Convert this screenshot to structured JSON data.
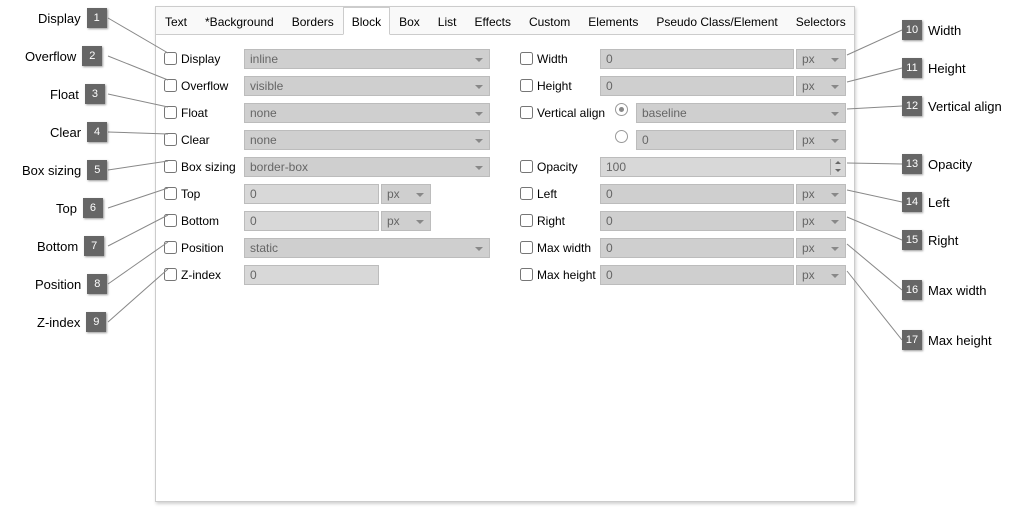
{
  "tabs": [
    "Text",
    "*Background",
    "Borders",
    "Block",
    "Box",
    "List",
    "Effects",
    "Custom",
    "Elements",
    "Pseudo Class/Element",
    "Selectors"
  ],
  "active_tab": 3,
  "left": {
    "display": {
      "label": "Display",
      "value": "inline"
    },
    "overflow": {
      "label": "Overflow",
      "value": "visible"
    },
    "float": {
      "label": "Float",
      "value": "none"
    },
    "clear": {
      "label": "Clear",
      "value": "none"
    },
    "boxsizing": {
      "label": "Box sizing",
      "value": "border-box"
    },
    "top": {
      "label": "Top",
      "value": "0",
      "unit": "px"
    },
    "bottom": {
      "label": "Bottom",
      "value": "0",
      "unit": "px"
    },
    "position": {
      "label": "Position",
      "value": "static"
    },
    "zindex": {
      "label": "Z-index",
      "value": "0"
    }
  },
  "right": {
    "width": {
      "label": "Width",
      "value": "0",
      "unit": "px"
    },
    "height": {
      "label": "Height",
      "value": "0",
      "unit": "px"
    },
    "valign": {
      "label": "Vertical align",
      "option": "baseline",
      "value": "0",
      "unit": "px"
    },
    "opacity": {
      "label": "Opacity",
      "value": "100"
    },
    "leftp": {
      "label": "Left",
      "value": "0",
      "unit": "px"
    },
    "rightp": {
      "label": "Right",
      "value": "0",
      "unit": "px"
    },
    "maxw": {
      "label": "Max width",
      "value": "0",
      "unit": "px"
    },
    "maxh": {
      "label": "Max height",
      "value": "0",
      "unit": "px"
    }
  },
  "callouts_left": [
    {
      "n": "1",
      "label": "Display"
    },
    {
      "n": "2",
      "label": "Overflow"
    },
    {
      "n": "3",
      "label": "Float"
    },
    {
      "n": "4",
      "label": "Clear"
    },
    {
      "n": "5",
      "label": "Box sizing"
    },
    {
      "n": "6",
      "label": "Top"
    },
    {
      "n": "7",
      "label": "Bottom"
    },
    {
      "n": "8",
      "label": "Position"
    },
    {
      "n": "9",
      "label": "Z-index"
    }
  ],
  "callouts_right": [
    {
      "n": "10",
      "label": "Width"
    },
    {
      "n": "11",
      "label": "Height"
    },
    {
      "n": "12",
      "label": "Vertical align"
    },
    {
      "n": "13",
      "label": "Opacity"
    },
    {
      "n": "14",
      "label": "Left"
    },
    {
      "n": "15",
      "label": "Right"
    },
    {
      "n": "16",
      "label": "Max width"
    },
    {
      "n": "17",
      "label": "Max height"
    }
  ]
}
